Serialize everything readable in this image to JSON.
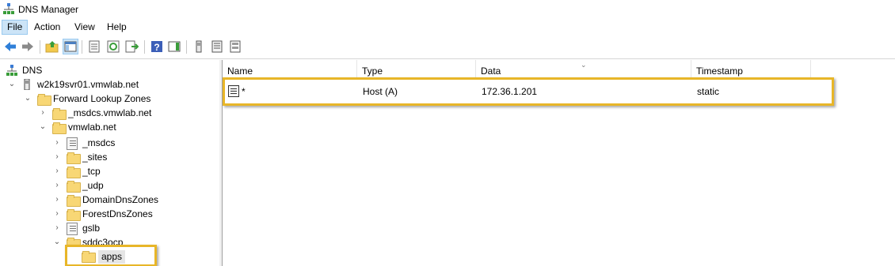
{
  "window": {
    "title": "DNS Manager",
    "app_icon": "dns-manager-icon"
  },
  "menu": {
    "items": [
      "File",
      "Action",
      "View",
      "Help"
    ],
    "active": "File"
  },
  "toolbar": {
    "buttons": [
      "back-arrow-icon",
      "forward-arrow-icon",
      "up-folder-icon",
      "show-hide-tree-icon",
      "properties-icon",
      "refresh-icon",
      "export-list-icon",
      "help-icon",
      "action-pane-icon",
      "server-icon",
      "zone-file-icon",
      "records-icon"
    ]
  },
  "tree": {
    "root": "DNS",
    "server": "w2k19svr01.vmwlab.net",
    "forward_lookup_zones": "Forward Lookup Zones",
    "zone_msdcs": "_msdcs.vmwlab.net",
    "zone_main": "vmwlab.net",
    "children": [
      "_msdcs",
      "_sites",
      "_tcp",
      "_udp",
      "DomainDnsZones",
      "ForestDnsZones",
      "gslb",
      "sddc3ocp"
    ],
    "selected_child": "apps"
  },
  "list": {
    "columns": [
      "Name",
      "Type",
      "Data",
      "Timestamp"
    ],
    "rows": [
      {
        "name": "*",
        "type": "Host (A)",
        "data": "172.36.1.201",
        "timestamp": "static"
      }
    ]
  },
  "colors": {
    "highlight": "#e8b628",
    "menu_active_bg": "#cce4f7"
  }
}
